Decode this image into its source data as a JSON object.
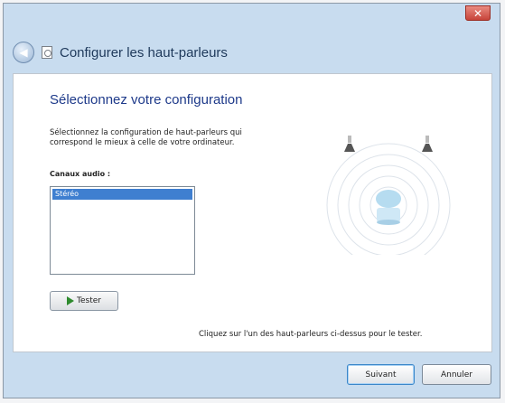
{
  "window": {
    "title": "Configurer les haut-parleurs",
    "close_glyph": "✕"
  },
  "main": {
    "heading": "Sélectionnez votre configuration",
    "description": "Sélectionnez la configuration de haut-parleurs qui correspond le mieux à celle de votre ordinateur.",
    "channels_label": "Canaux audio :",
    "channels_options": [
      "Stéréo"
    ],
    "selected_channel": "Stéréo",
    "test_button": "Tester",
    "hint": "Cliquez sur l'un des haut-parleurs ci-dessus pour le tester."
  },
  "footer": {
    "next_button": "Suivant",
    "cancel_button": "Annuler"
  },
  "icons": {
    "back": "back-arrow-icon",
    "speaker": "speaker-icon",
    "play": "play-icon",
    "close": "close-icon"
  },
  "colors": {
    "accent": "#3f7fd0",
    "frame": "#c8dcef",
    "heading": "#1e3a8a",
    "close": "#c7443a"
  }
}
